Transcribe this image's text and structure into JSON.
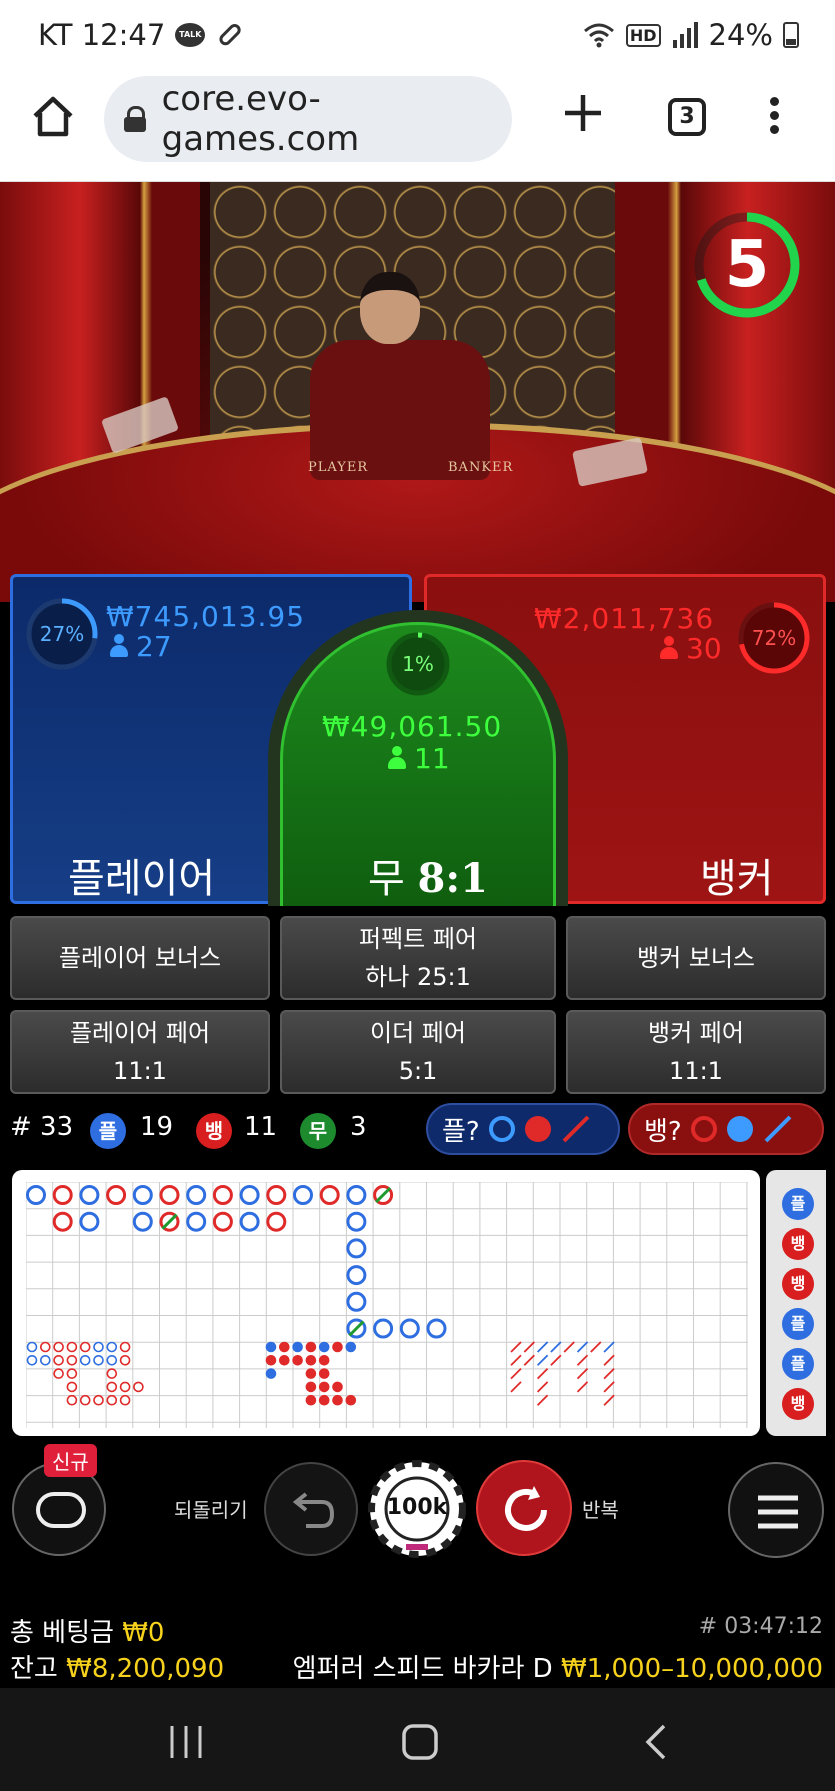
{
  "status_bar": {
    "carrier_time": "KT 12:47",
    "talk_badge": "TALK",
    "hd": "HD",
    "battery": "24%"
  },
  "browser": {
    "url": "core.evo-games.com",
    "tab_count": "3"
  },
  "game": {
    "timer": "5",
    "table_labels": {
      "player": "PLAYER",
      "banker": "BANKER"
    },
    "player": {
      "percent": "27%",
      "amount": "₩745,013.95",
      "count": "27",
      "label": "플레이어"
    },
    "tie": {
      "percent": "1%",
      "amount": "₩49,061.50",
      "count": "11",
      "label": "무",
      "odds": "8:1"
    },
    "banker": {
      "percent": "72%",
      "amount": "₩2,011,736",
      "count": "30",
      "label": "뱅커"
    },
    "side_bets": {
      "player_bonus": "플레이어 보너스",
      "perfect_pair_1": "퍼펙트 페어",
      "perfect_pair_2": "하나 25:1",
      "banker_bonus": "뱅커 보너스",
      "player_pair_1": "플레이어 페어",
      "player_pair_2": "11:1",
      "either_pair_1": "이더 페어",
      "either_pair_2": "5:1",
      "banker_pair_1": "뱅커 페어",
      "banker_pair_2": "11:1"
    },
    "stats": {
      "round": "# 33",
      "player_badge": "플",
      "player_count": "19",
      "banker_badge": "뱅",
      "banker_count": "11",
      "tie_badge": "무",
      "tie_count": "3"
    },
    "ask": {
      "player": "플?",
      "banker": "뱅?"
    },
    "side_road": [
      "플",
      "뱅",
      "뱅",
      "플",
      "플",
      "뱅"
    ],
    "controls": {
      "new_badge": "신규",
      "undo": "되돌리기",
      "chip": "100k",
      "repeat": "반복"
    },
    "footer": {
      "total_bet_label": "총 베팅금",
      "total_bet": "₩0",
      "game_id": "# 03:47:12",
      "balance_label": "잔고",
      "balance": "₩8,200,090",
      "table_name": "엠퍼러 스피드 바카라 D",
      "limits": "₩1,000–10,000,000"
    }
  },
  "colors": {
    "player": "#2e6ee0",
    "banker": "#e02a2a",
    "tie": "#30c030",
    "accent": "#f7d21c"
  },
  "icons": [
    "home-icon",
    "lock-icon",
    "plus-icon",
    "tabs-icon",
    "more-icon",
    "person-icon",
    "undo-icon",
    "repeat-icon",
    "hamburger-icon",
    "recents-icon",
    "home-nav-icon",
    "back-icon"
  ]
}
